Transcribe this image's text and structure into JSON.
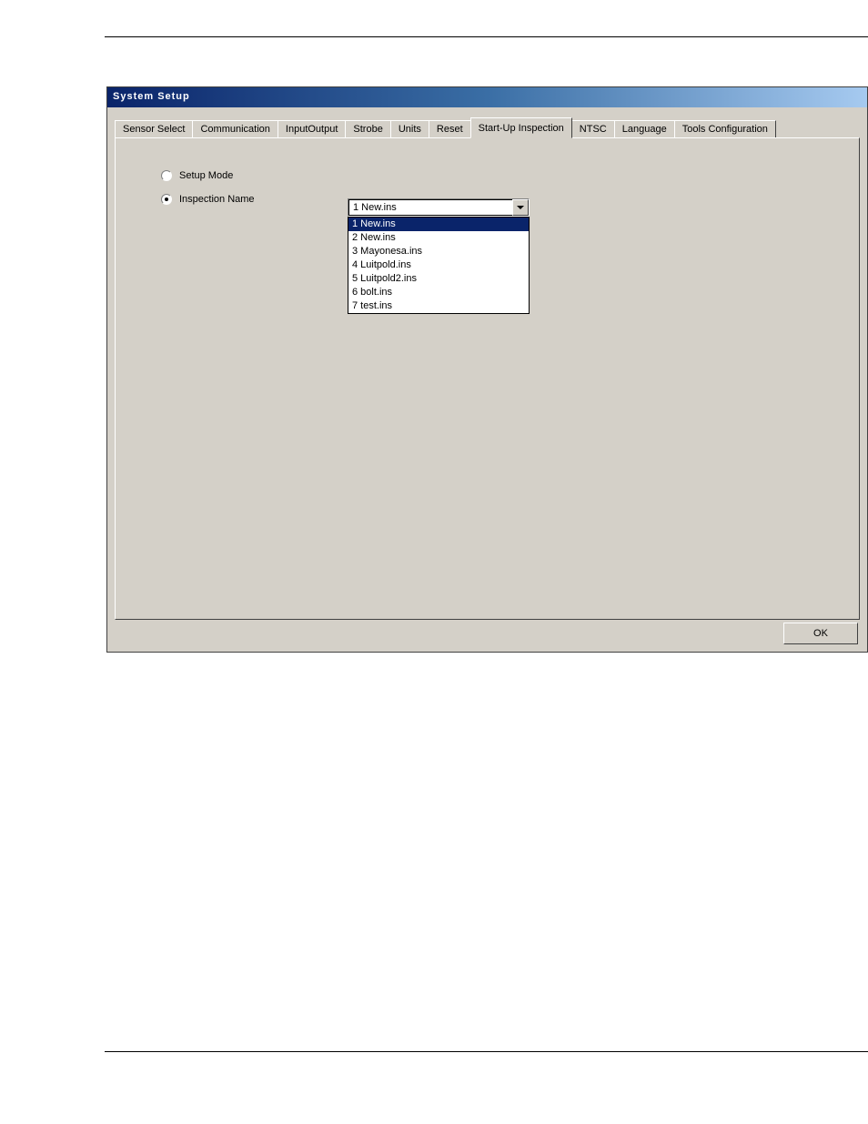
{
  "window": {
    "title": "System  Setup"
  },
  "tabs": [
    {
      "label": "Sensor Select"
    },
    {
      "label": "Communication"
    },
    {
      "label": "InputOutput"
    },
    {
      "label": "Strobe"
    },
    {
      "label": "Units"
    },
    {
      "label": "Reset"
    },
    {
      "label": "Start-Up Inspection"
    },
    {
      "label": "NTSC"
    },
    {
      "label": "Language"
    },
    {
      "label": "Tools Configuration"
    }
  ],
  "radios": {
    "setup_mode": "Setup Mode",
    "inspection_name": "Inspection Name"
  },
  "combo": {
    "selected": "1  New.ins",
    "options": [
      "1  New.ins",
      "2  New.ins",
      "3  Mayonesa.ins",
      "4  Luitpold.ins",
      "5  Luitpold2.ins",
      "6  bolt.ins",
      "7  test.ins"
    ]
  },
  "buttons": {
    "ok": "OK"
  }
}
